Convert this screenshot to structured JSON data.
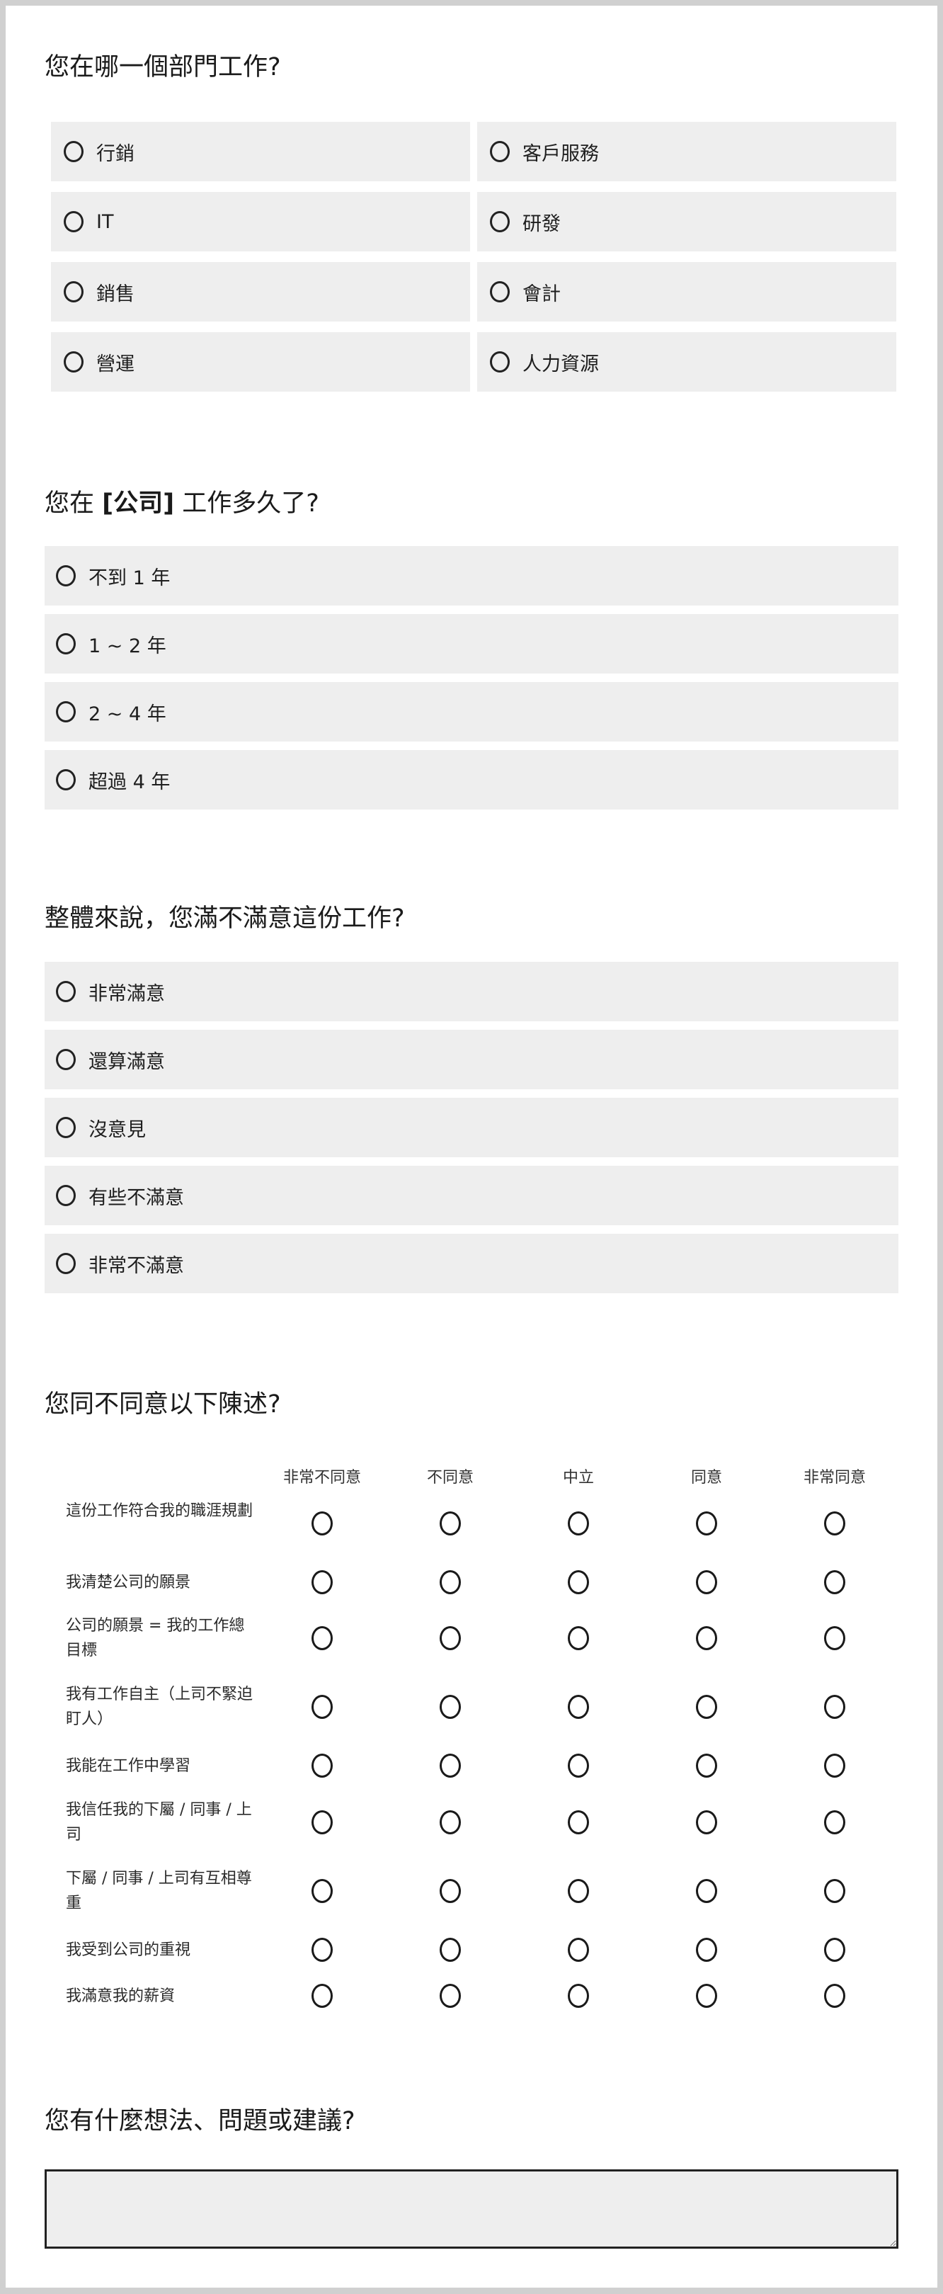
{
  "q1": {
    "title": "您在哪一個部門工作?",
    "options": [
      "行銷",
      "客戶服務",
      "IT",
      "研發",
      "銷售",
      "會計",
      "營運",
      "人力資源"
    ]
  },
  "q2": {
    "title_prefix": "您在 ",
    "title_bold": "[公司]",
    "title_suffix": " 工作多久了?",
    "options": [
      "不到 1 年",
      "1 ~ 2 年",
      "2 ~ 4 年",
      "超過 4 年"
    ]
  },
  "q3": {
    "title": "整體來說，您滿不滿意這份工作?",
    "options": [
      "非常滿意",
      "還算滿意",
      "沒意見",
      "有些不滿意",
      "非常不滿意"
    ]
  },
  "q4": {
    "title": "您同不同意以下陳述?",
    "columns": [
      "非常不同意",
      "不同意",
      "中立",
      "同意",
      "非常同意"
    ],
    "rows": [
      "這份工作符合我的職涯規劃",
      "我清楚公司的願景",
      "公司的願景 = 我的工作總目標",
      "我有工作自主（上司不緊迫盯人）",
      "我能在工作中學習",
      "我信任我的下屬 / 同事 / 上司",
      "下屬 / 同事 / 上司有互相尊重",
      "我受到公司的重視",
      "我滿意我的薪資"
    ]
  },
  "q5": {
    "title": "您有什麼想法、問題或建議?",
    "value": "",
    "placeholder": ""
  }
}
